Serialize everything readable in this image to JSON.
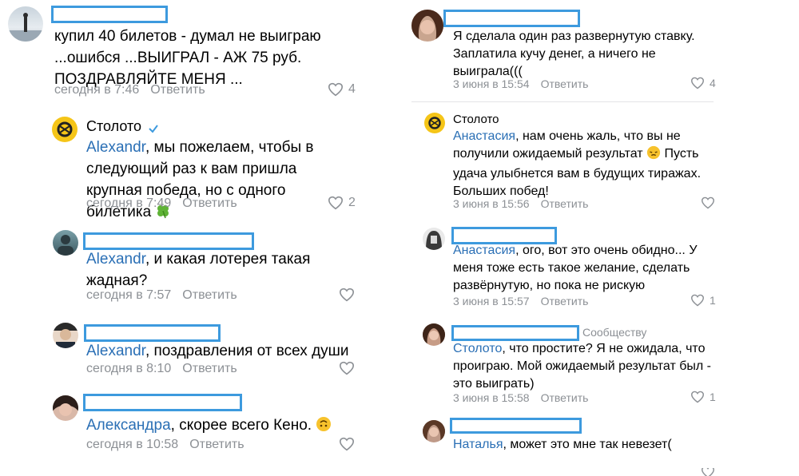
{
  "brand_color": "#3d9ade",
  "link_color": "#2a6fb5",
  "meta_color": "#8c9095",
  "left": {
    "c1": {
      "text": "купил 40 билетов - думал не выиграю ...ошибся ...ВЫИГРАЛ - АЖ 75 руб. ПОЗДРАВЛЯЙТЕ МЕНЯ ...",
      "time": "сегодня в 7:46",
      "reply": "Ответить",
      "likes": "4"
    },
    "c2": {
      "author": "Столото",
      "mention": "Alexandr",
      "text": ", мы пожелаем, чтобы в следующий раз к вам пришла крупная победа, но с одного билетика",
      "time": "сегодня в 7:49",
      "reply": "Ответить",
      "likes": "2"
    },
    "c3": {
      "mention": "Alexandr",
      "text": ", и какая лотерея такая жадная?",
      "time": "сегодня в 7:57",
      "reply": "Ответить"
    },
    "c4": {
      "mention": "Alexandr",
      "text": ", поздравления от всех души",
      "time": "сегодня в 8:10",
      "reply": "Ответить"
    },
    "c5": {
      "mention": "Александра",
      "text": ", скорее всего Кено.",
      "time": "сегодня в 10:58",
      "reply": "Ответить"
    }
  },
  "right": {
    "c1": {
      "text": "Я сделала один раз развернутую ставку. Заплатила кучу денег, а ничего не выиграла(((",
      "time": "3 июня в 15:54",
      "reply": "Ответить",
      "likes": "4"
    },
    "c2": {
      "author": "Столото",
      "mention": "Анастасия",
      "text": ", нам очень жаль, что вы не получили ожидаемый результат",
      "text2": " Пусть удача улыбнется вам в будущих тиражах. Больших побед!",
      "time": "3 июня в 15:56",
      "reply": "Ответить"
    },
    "c3": {
      "mention": "Анастасия",
      "text": ", ого, вот это очень обидно... У меня тоже есть такое желание, сделать развёрнутую, но пока не рискую",
      "time": "3 июня в 15:57",
      "reply": "Ответить",
      "likes": "1"
    },
    "c4": {
      "community": "Сообществу",
      "mention": "Столото",
      "text": ", что простите? Я не ожидала, что проиграю. Мой ожидаемый результат был - это выиграть)",
      "time": "3 июня в 15:58",
      "reply": "Ответить",
      "likes": "1"
    },
    "c5": {
      "mention": "Наталья",
      "text": ", может это мне так невезет("
    }
  }
}
